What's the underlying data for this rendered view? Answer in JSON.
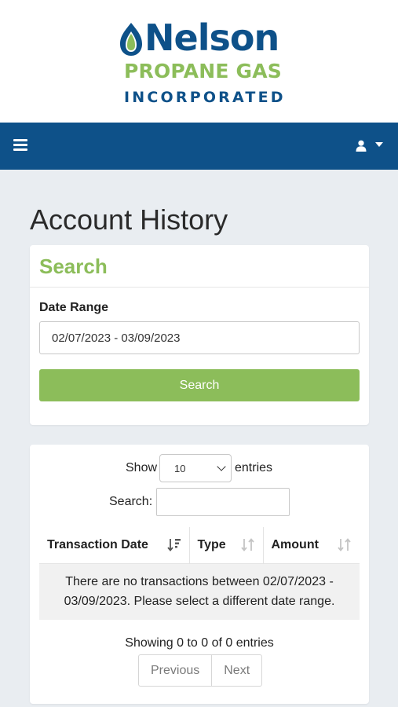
{
  "brand": {
    "name": "Nelson",
    "line1": "PROPANE GAS",
    "line2": "INCORPORATED",
    "colors": {
      "primary": "#0e5189",
      "accent": "#8cbd5a"
    }
  },
  "navbar": {
    "menu_icon": "hamburger-icon",
    "user_icon": "user-icon"
  },
  "page": {
    "title": "Account History"
  },
  "search": {
    "title": "Search",
    "date_range_label": "Date Range",
    "date_range_value": "02/07/2023 - 03/09/2023",
    "button_label": "Search"
  },
  "table": {
    "show_label": "Show",
    "entries_value": "10",
    "entries_label": "entries",
    "filter_label": "Search:",
    "filter_value": "",
    "columns": [
      "Transaction Date",
      "Type",
      "Amount"
    ],
    "empty_message": "There are no transactions between 02/07/2023 - 03/09/2023. Please select a different date range.",
    "info": "Showing 0 to 0 of 0 entries",
    "pager": {
      "previous": "Previous",
      "next": "Next"
    }
  }
}
